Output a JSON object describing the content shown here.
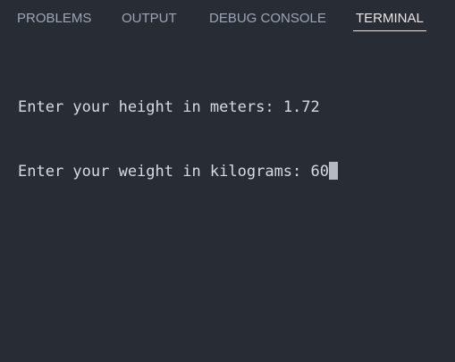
{
  "tabs": [
    {
      "label": "PROBLEMS",
      "active": false
    },
    {
      "label": "OUTPUT",
      "active": false
    },
    {
      "label": "DEBUG CONSOLE",
      "active": false
    },
    {
      "label": "TERMINAL",
      "active": true
    }
  ],
  "terminal": {
    "lines": [
      {
        "prompt": "Enter your height in meters: ",
        "input": "1.72"
      },
      {
        "prompt": "Enter your weight in kilograms: ",
        "input": "60"
      }
    ]
  },
  "colors": {
    "background": "#282c34",
    "tab_inactive": "#9da5b4",
    "tab_active": "#e6e6e6",
    "terminal_text": "#d7dae0",
    "cursor": "#b5b9c2"
  },
  "icons": {
    "cursor": "block-cursor"
  }
}
